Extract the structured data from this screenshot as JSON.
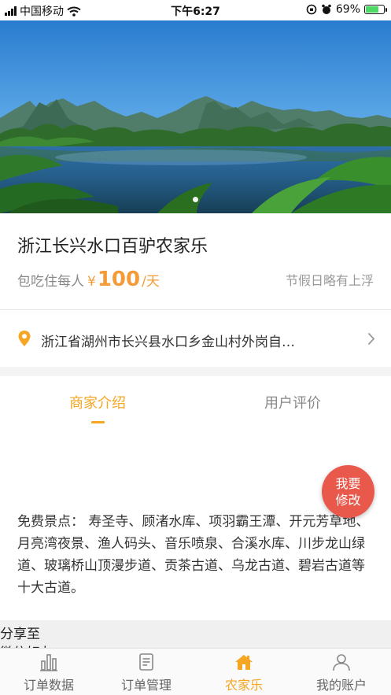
{
  "status_bar": {
    "carrier": "中国移动",
    "time": "下午6:27",
    "battery_percent": "69%",
    "battery_level": 0.69
  },
  "hero": {
    "slides_total": 2,
    "active_slide": 1
  },
  "listing": {
    "name": "浙江长兴水口百驴农家乐",
    "price_prefix": "包吃住每人",
    "currency": "¥",
    "price": "100",
    "price_unit": "/天",
    "holiday_note": "节假日略有上浮"
  },
  "address": {
    "text": "浙江省湖州市长兴县水口乡金山村外岗自…"
  },
  "tabs": [
    {
      "label": "商家介绍",
      "active": true
    },
    {
      "label": "用户评价",
      "active": false
    }
  ],
  "intro": {
    "text": "免费景点： 寿圣寺、顾渚水库、项羽霸王潭、开元芳草地、月亮湾夜景、渔人码头、音乐喷泉、合溪水库、川步龙山绿道、玻璃桥山顶漫步道、贡茶古道、乌龙古道、碧岩古道等十大古道。"
  },
  "edit_button": {
    "line1": "我要",
    "line2": "修改"
  },
  "share": {
    "label": "分享至",
    "sub_label": "微信好友"
  },
  "tabbar": [
    {
      "label": "订单数据",
      "icon": "bar-chart-icon",
      "active": false
    },
    {
      "label": "订单管理",
      "icon": "document-list-icon",
      "active": false
    },
    {
      "label": "农家乐",
      "icon": "farmhouse-icon",
      "active": true
    },
    {
      "label": "我的账户",
      "icon": "user-icon",
      "active": false
    }
  ],
  "colors": {
    "accent": "#f5a623",
    "price": "#f39c37",
    "edit_button": "#e8584b"
  }
}
